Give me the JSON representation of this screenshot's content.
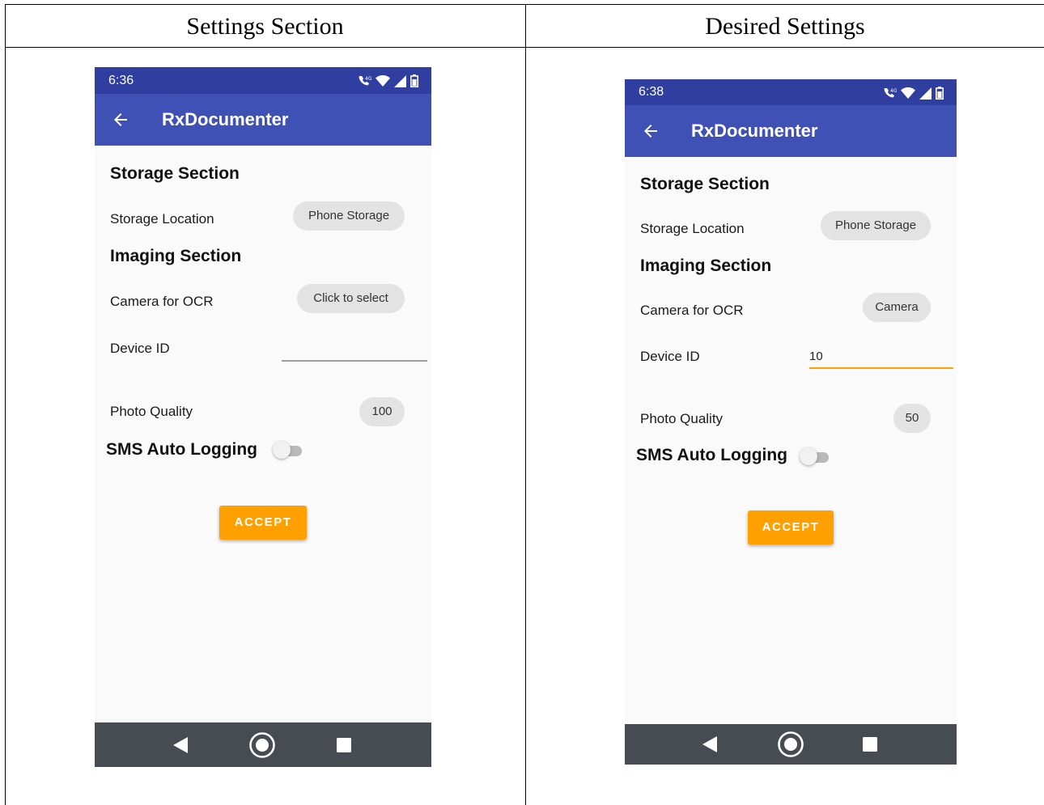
{
  "headers": {
    "left": "Settings Section",
    "right": "Desired Settings"
  },
  "phones": {
    "left": {
      "status_time": "6:36",
      "app_title": "RxDocumenter",
      "storage_section": "Storage Section",
      "storage_location_label": "Storage Location",
      "storage_location_value": "Phone Storage",
      "imaging_section": "Imaging Section",
      "camera_label": "Camera for OCR",
      "camera_value": "Click to select",
      "device_id_label": "Device ID",
      "device_id_value": "",
      "photo_quality_label": "Photo Quality",
      "photo_quality_value": "100",
      "sms_label": "SMS Auto Logging",
      "sms_enabled": false,
      "accept_label": "ACCEPT"
    },
    "right": {
      "status_time": "6:38",
      "app_title": "RxDocumenter",
      "storage_section": "Storage Section",
      "storage_location_label": "Storage Location",
      "storage_location_value": "Phone Storage",
      "imaging_section": "Imaging Section",
      "camera_label": "Camera for OCR",
      "camera_value": "Camera",
      "device_id_label": "Device ID",
      "device_id_value": "10",
      "photo_quality_label": "Photo Quality",
      "photo_quality_value": "50",
      "sms_label": "SMS Auto Logging",
      "sms_enabled": false,
      "accept_label": "ACCEPT"
    }
  },
  "colors": {
    "status_bar": "#303f9f",
    "app_bar": "#3f51b5",
    "accent": "#ffa000",
    "nav_bar": "#474c52"
  },
  "icons": {
    "status": [
      "wifi-calling-icon",
      "wifi-icon",
      "cell-signal-icon",
      "battery-icon"
    ],
    "app_bar": "back-arrow-icon",
    "nav": [
      "nav-back-icon",
      "nav-home-icon",
      "nav-recents-icon"
    ]
  }
}
